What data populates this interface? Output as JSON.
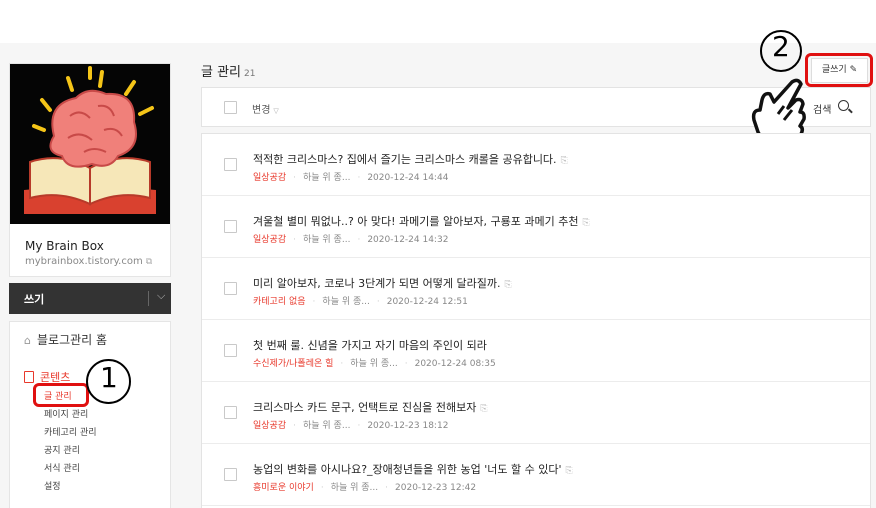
{
  "blog": {
    "name": "My Brain Box",
    "url": "mybrainbox.tistory.com"
  },
  "sidebar": {
    "write_label": "쓰기",
    "home_label": "블로그관리 홈",
    "contents_label": "콘텐츠",
    "sub_items": [
      {
        "label": "글 관리",
        "active": true
      },
      {
        "label": "페이지 관리"
      },
      {
        "label": "카테고리 관리"
      },
      {
        "label": "공지 관리"
      },
      {
        "label": "서식 관리"
      },
      {
        "label": "설정"
      }
    ]
  },
  "main": {
    "title": "글 관리",
    "count": "21",
    "write_button": "글쓰기 ✎",
    "toolbar": {
      "change_label": "변경",
      "search_label": "검색"
    },
    "posts": [
      {
        "title": "적적한 크리스마스? 집에서 즐기는 크리스마스 캐롤을 공유합니다.",
        "category": "일상공감",
        "author": "하늘 위 종...",
        "date": "2020-12-24 14:44"
      },
      {
        "title": "겨울철 별미 뭐없나..? 아 맞다! 과메기를 알아보자, 구룡포 과메기 추천",
        "category": "일상공감",
        "author": "하늘 위 종...",
        "date": "2020-12-24 14:32"
      },
      {
        "title": "미리 알아보자, 코로나 3단계가 되면 어떻게 달라질까.",
        "category": "카테고리 없음",
        "author": "하늘 위 종...",
        "date": "2020-12-24 12:51"
      },
      {
        "title": "첫 번째 룰. 신념을 가지고 자기 마음의 주인이 되라",
        "category": "수신제가/나폴레온 힐",
        "author": "하늘 위 종...",
        "date": "2020-12-24 08:35"
      },
      {
        "title": "크리스마스 카드 문구, 언택트로 진심을 전해보자",
        "category": "일상공감",
        "author": "하늘 위 종...",
        "date": "2020-12-23 18:12"
      },
      {
        "title": "농업의 변화를 아시나요?_장애청년들을 위한 농업 '너도 할 수 있다'",
        "category": "흥미로운 이야기",
        "author": "하늘 위 종...",
        "date": "2020-12-23 12:42"
      }
    ]
  },
  "annotations": {
    "step1": "1",
    "step2": "2"
  },
  "icons": {
    "home": "home-icon",
    "contents": "document-icon",
    "clip": "paperclip-icon",
    "search": "search-icon",
    "hand": "pointing-hand-icon"
  },
  "colors": {
    "accent": "#e8382b",
    "highlight": "#e01010",
    "dark_bar": "#333333"
  }
}
